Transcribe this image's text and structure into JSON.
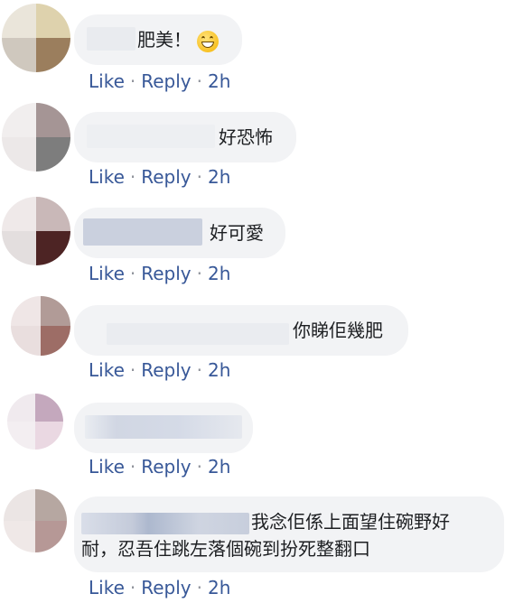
{
  "actions": {
    "like": "Like",
    "reply": "Reply",
    "dot": "·",
    "time": "2h"
  },
  "comments": [
    {
      "text": "肥美！",
      "has_emoji": true,
      "emoji_name": "grinning-face-emoji"
    },
    {
      "text": "好恐怖"
    },
    {
      "text": "好可愛"
    },
    {
      "text": "你睇佢幾肥"
    },
    {
      "text": ""
    },
    {
      "text_line1": "我念佢係上面望住碗野好",
      "text_line2": "耐，忍吾住跳左落個碗到扮死整翻口"
    }
  ],
  "colors": {
    "bubble": "#f2f3f5",
    "link": "#385898",
    "text": "#1c1e21",
    "separator": "#90949c"
  }
}
